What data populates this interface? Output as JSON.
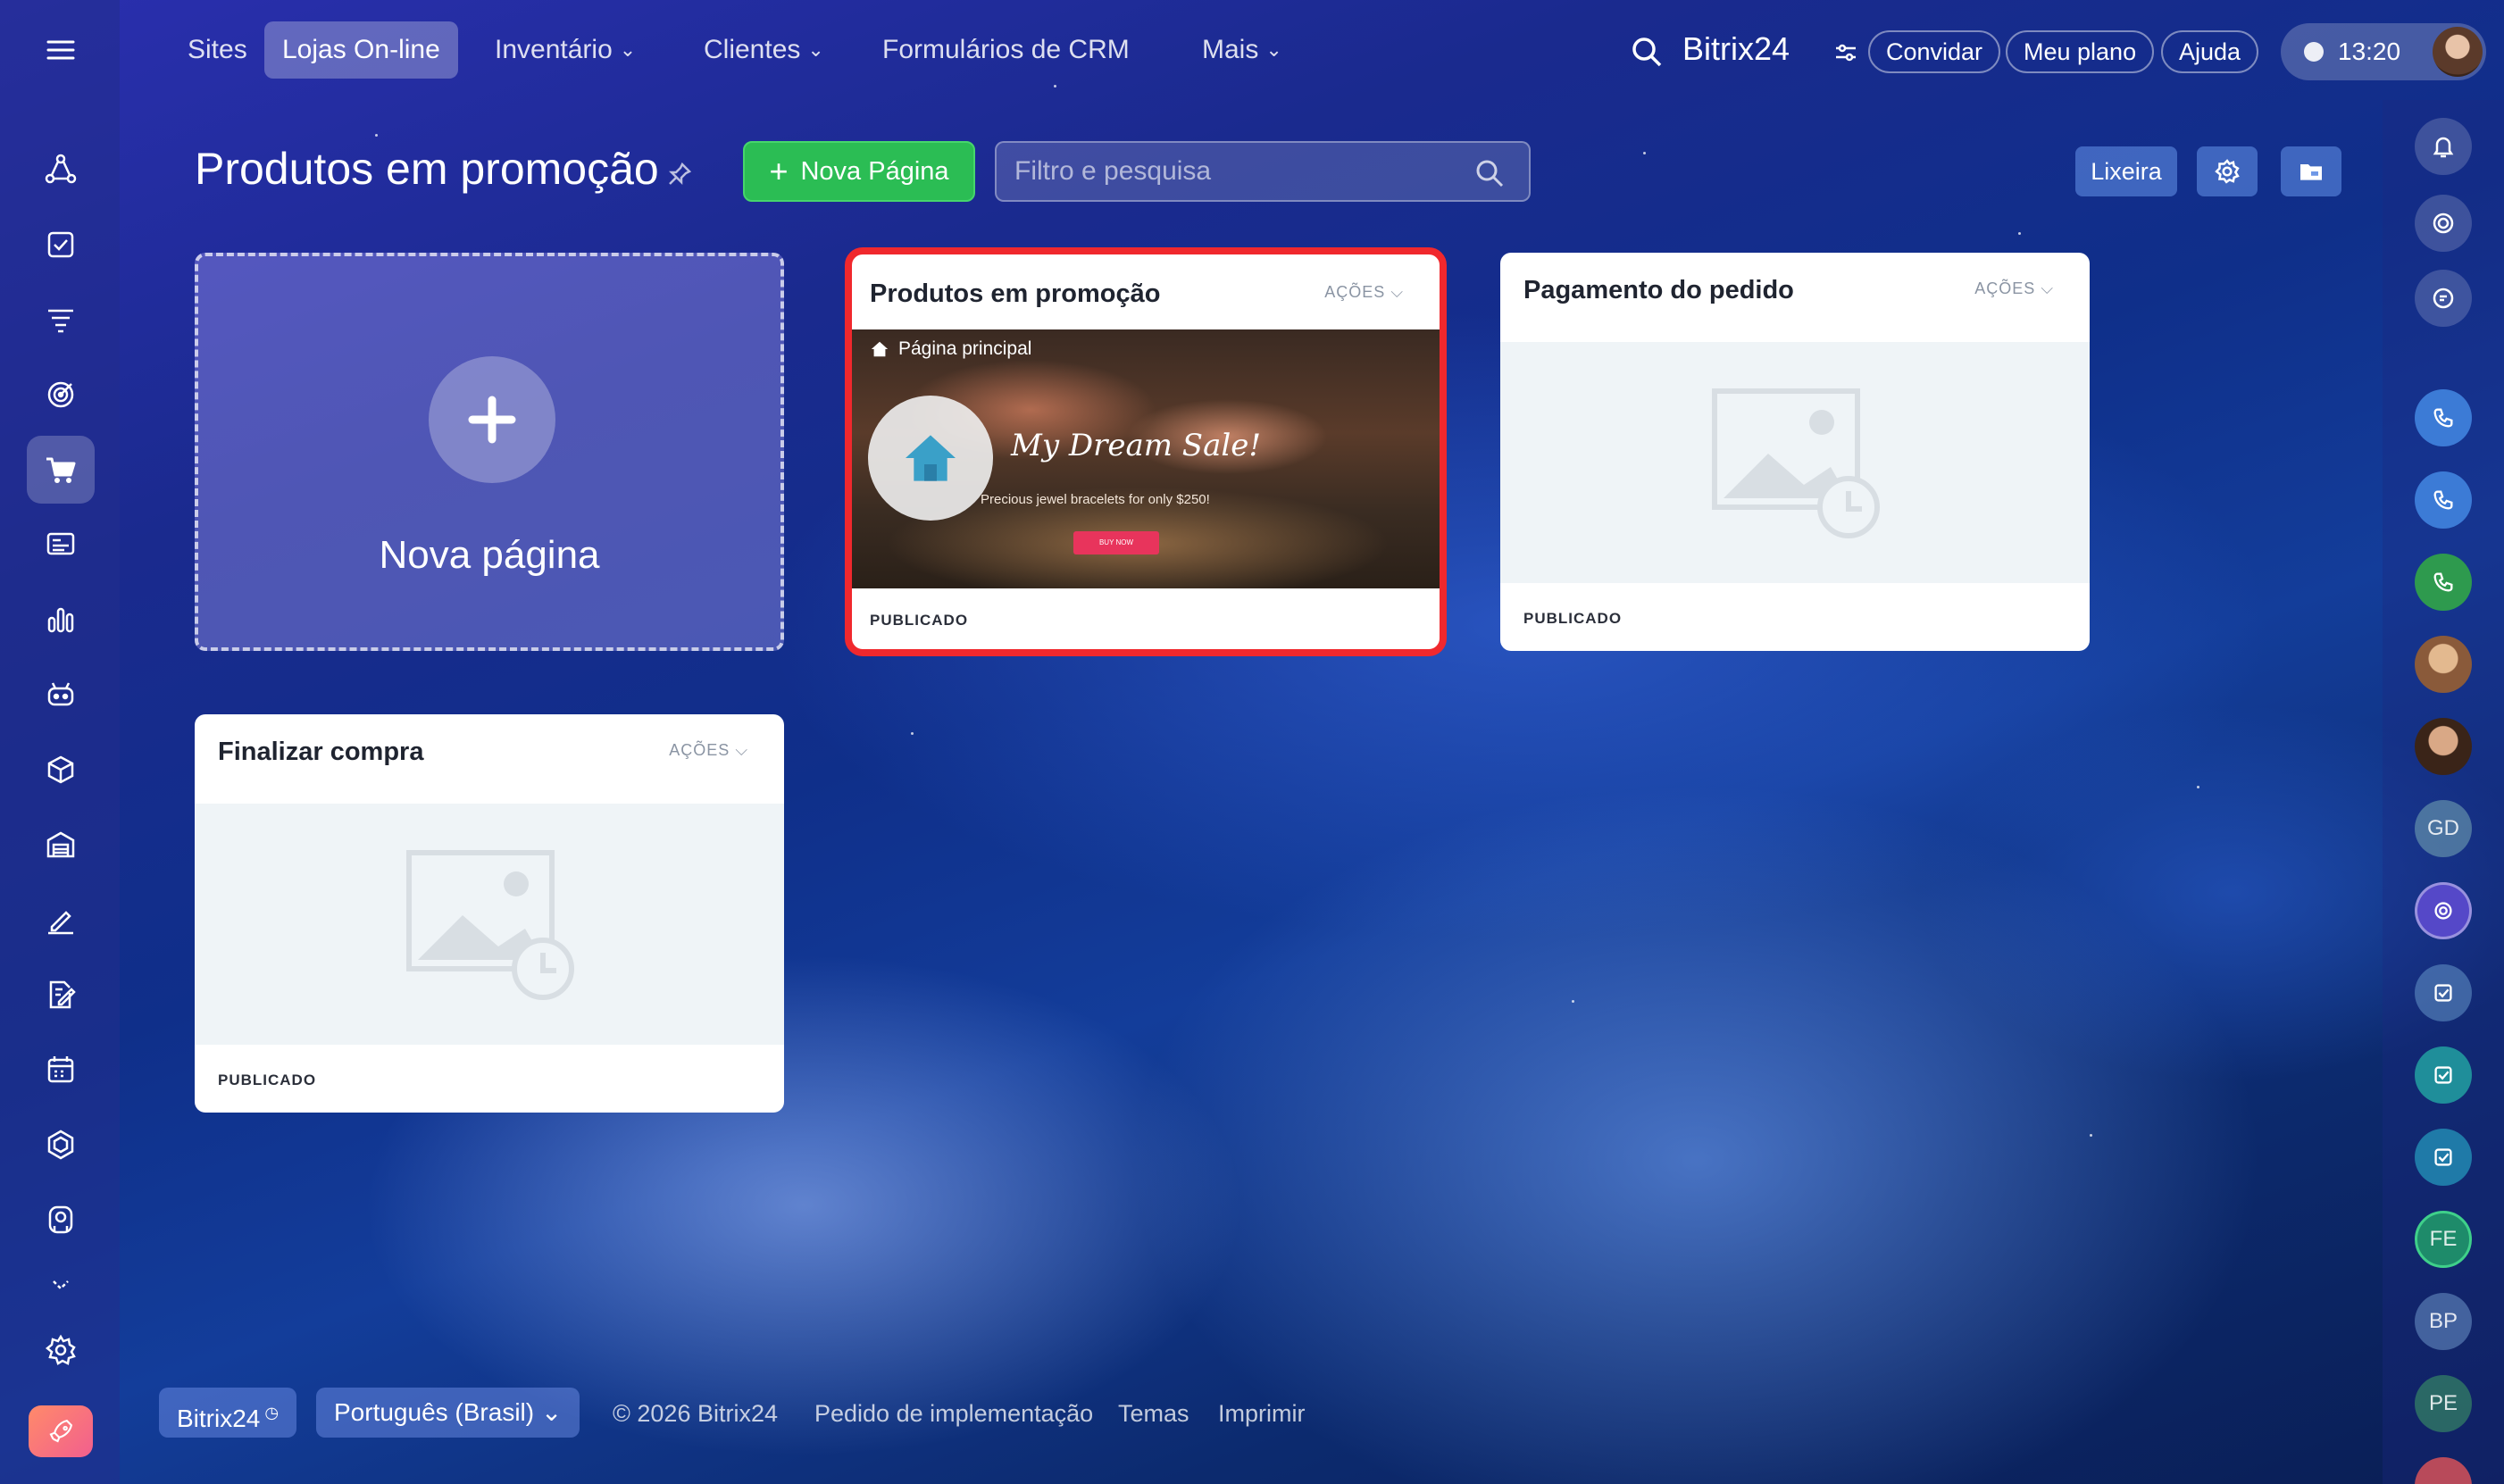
{
  "topnav": {
    "items": [
      {
        "label": "Sites"
      },
      {
        "label": "Lojas On-line"
      },
      {
        "label": "Inventário"
      },
      {
        "label": "Clientes"
      },
      {
        "label": "Formulários de CRM"
      },
      {
        "label": "Mais"
      }
    ],
    "brand": "Bitrix24",
    "invite": "Convidar",
    "plan": "Meu plano",
    "help": "Ajuda",
    "time": "13:20"
  },
  "header": {
    "title": "Produtos em promoção",
    "new_page_button": "Nova Página",
    "filter_placeholder": "Filtro e pesquisa",
    "trash": "Lixeira"
  },
  "new_card": {
    "label": "Nova página"
  },
  "cards": [
    {
      "title": "Produtos em promoção",
      "actions": "AÇÕES",
      "status": "PUBLICADO",
      "preview": {
        "tag": "Página principal",
        "headline": "My Dream Sale!",
        "subline": "Precious jewel bracelets for only $250!",
        "button": "BUY NOW"
      }
    },
    {
      "title": "Pagamento do pedido",
      "actions": "AÇÕES",
      "status": "PUBLICADO"
    },
    {
      "title": "Finalizar compra",
      "actions": "AÇÕES",
      "status": "PUBLICADO"
    }
  ],
  "rightbar": {
    "initials": [
      "GD",
      "FE",
      "BP",
      "PE"
    ]
  },
  "footer": {
    "brand": "Bitrix24",
    "language": "Português (Brasil)",
    "copyright": "© 2026 Bitrix24",
    "links": [
      "Pedido de implementação",
      "Temas",
      "Imprimir"
    ]
  },
  "colors": {
    "accent_green": "#2bbd54",
    "selection_red": "#f0282d",
    "background_blue": "#1a2a8e"
  }
}
